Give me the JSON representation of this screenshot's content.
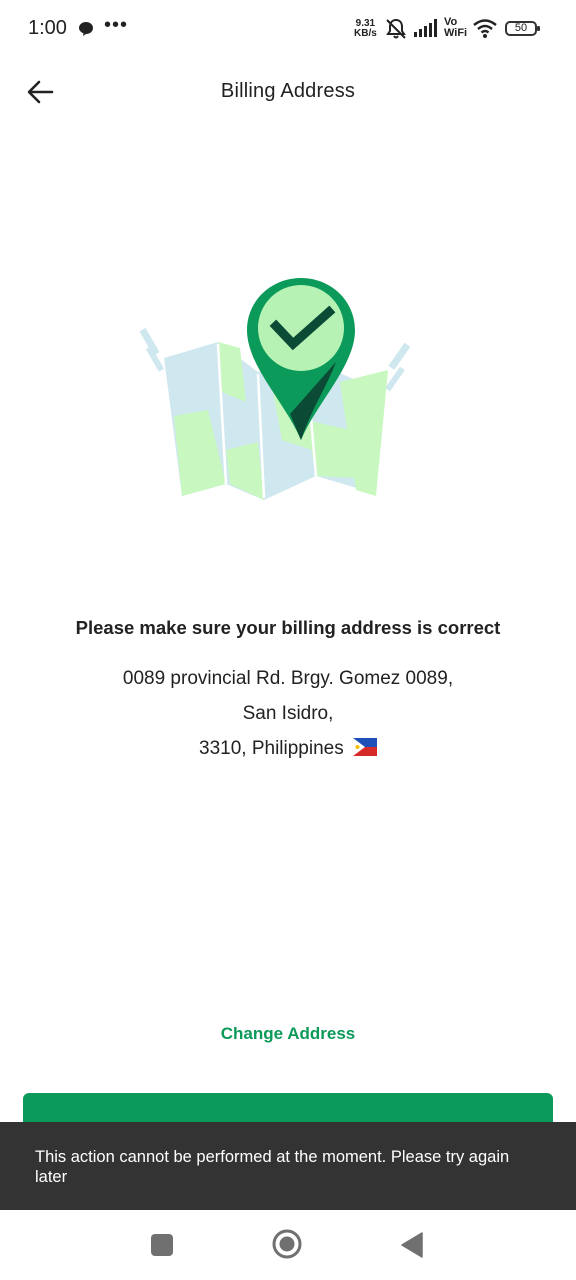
{
  "status_bar": {
    "time": "1:00",
    "more": "•••",
    "speed_value": "9.31",
    "speed_unit": "KB/s",
    "vo": "Vo",
    "wifi_label": "WiFi",
    "battery": "50"
  },
  "header": {
    "title": "Billing Address",
    "back_icon": "arrow-left-icon"
  },
  "illustration": {
    "icon": "map-location-check-icon",
    "colors": {
      "pin": "#0c9a5a",
      "pin_light": "#b6f2b4",
      "map_blue": "#cfe8f0",
      "map_green": "#c8f7bf"
    }
  },
  "main": {
    "heading": "Please make sure your billing address is correct",
    "address_line1": "0089 provincial Rd. Brgy. Gomez 0089,",
    "address_line2": "San Isidro,",
    "address_line3": "3310, Philippines",
    "flag_icon": "philippines-flag-icon"
  },
  "actions": {
    "change_address": "Change Address"
  },
  "snackbar": {
    "message": "This action cannot be performed at the moment. Please try again later"
  },
  "colors": {
    "accent": "#0c9a5a",
    "snackbar_bg": "#333333"
  }
}
